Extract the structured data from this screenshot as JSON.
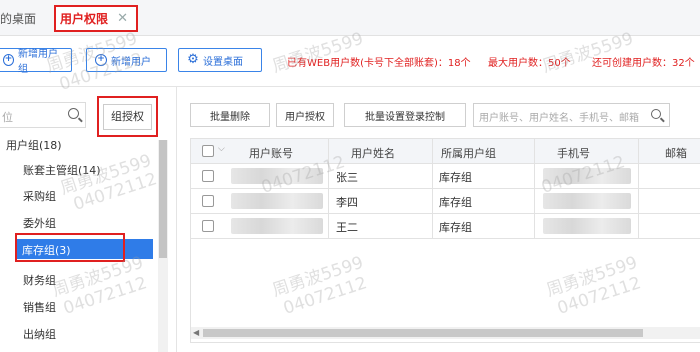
{
  "tabs": {
    "prev_label": "的桌面",
    "active_label": "用户权限",
    "close_glyph": "✕"
  },
  "toolbar": {
    "add_group_label": "新增用户组",
    "add_user_label": "新增用户",
    "desktop_settings_label": "设置桌面"
  },
  "stats": {
    "web_users": "已有WEB用户数(卡号下全部账套)：18个",
    "max_users": "最大用户数：50个",
    "can_create": "还可创建用户数：32个"
  },
  "sidebar": {
    "search_placeholder": "位",
    "group_auth_label": "组授权",
    "root_label": "用户组(18)",
    "items": [
      {
        "label": "账套主管组(14)"
      },
      {
        "label": "采购组"
      },
      {
        "label": "委外组"
      },
      {
        "label": "库存组(3)"
      },
      {
        "label": "财务组"
      },
      {
        "label": "销售组"
      },
      {
        "label": "出纳组"
      }
    ],
    "selected_index": 3
  },
  "actions": {
    "batch_delete_label": "批量删除",
    "user_auth_label": "用户授权",
    "batch_login_label": "批量设置登录控制",
    "search_placeholder": "用户账号、用户姓名、手机号、邮箱"
  },
  "table": {
    "columns": [
      "用户账号",
      "用户姓名",
      "所属用户组",
      "手机号",
      "邮箱"
    ],
    "rows": [
      {
        "name": "张三",
        "group": "库存组"
      },
      {
        "name": "李四",
        "group": "库存组"
      },
      {
        "name": "王二",
        "group": "库存组"
      }
    ]
  },
  "watermark": [
    "周勇波5599",
    "04072112"
  ],
  "colors": {
    "accent": "#2f7ce8",
    "alert": "#e02020"
  }
}
